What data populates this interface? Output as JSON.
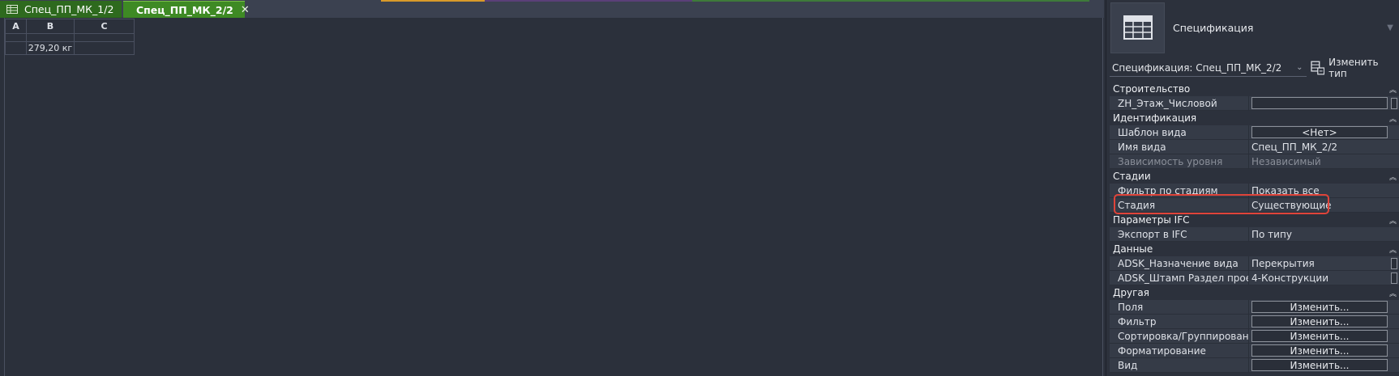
{
  "tabs": [
    {
      "label": "Спец_ПП_МК_1/2",
      "active": false
    },
    {
      "label": "Спец_ПП_МК_2/2",
      "active": true
    }
  ],
  "schedule": {
    "headers": [
      "A",
      "B",
      "C"
    ],
    "rows": [
      [
        "",
        "279,20 кг",
        ""
      ]
    ]
  },
  "properties": {
    "type_name": "Спецификация",
    "type_selector": "Спецификация: Спец_ПП_МК_2/2",
    "edit_type_label": "Изменить тип",
    "groups": {
      "construction": {
        "title": "Строительство",
        "rows": [
          {
            "name": "ZH_Этаж_Числовой",
            "value": ""
          }
        ]
      },
      "identity": {
        "title": "Идентификация",
        "rows": [
          {
            "name": "Шаблон вида",
            "value": "<Нет>"
          },
          {
            "name": "Имя вида",
            "value": "Спец_ПП_МК_2/2"
          },
          {
            "name": "Зависимость уровня",
            "value": "Независимый"
          }
        ]
      },
      "phasing": {
        "title": "Стадии",
        "rows": [
          {
            "name": "Фильтр по стадиям",
            "value": "Показать все"
          },
          {
            "name": "Стадия",
            "value": "Существующие"
          }
        ]
      },
      "ifc": {
        "title": "Параметры IFC",
        "rows": [
          {
            "name": "Экспорт в IFC",
            "value": "По типу"
          }
        ]
      },
      "data": {
        "title": "Данные",
        "rows": [
          {
            "name": "ADSK_Назначение вида",
            "value": "Перекрытия"
          },
          {
            "name": "ADSK_Штамп Раздел проекта",
            "value": "4-Конструкции"
          }
        ]
      },
      "other": {
        "title": "Другая",
        "rows": [
          {
            "name": "Поля",
            "value": "Изменить..."
          },
          {
            "name": "Фильтр",
            "value": "Изменить..."
          },
          {
            "name": "Сортировка/Группирование",
            "value": "Изменить..."
          },
          {
            "name": "Форматирование",
            "value": "Изменить..."
          },
          {
            "name": "Вид",
            "value": "Изменить..."
          }
        ]
      }
    }
  },
  "colors": {
    "highlight": "#e0443a",
    "tab_active": "#3e8a24",
    "tab_inactive": "#2e6a1e",
    "background": "#2b303b"
  }
}
